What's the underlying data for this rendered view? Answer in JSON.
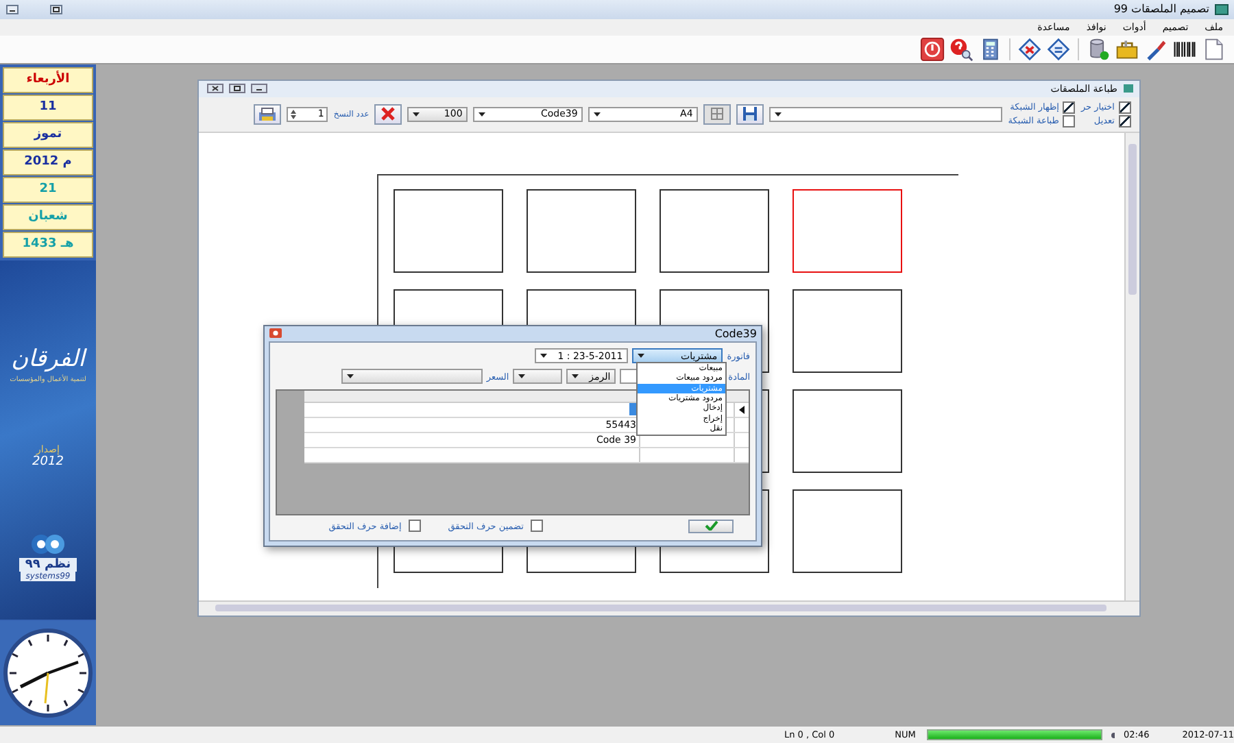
{
  "window": {
    "title": "تصميم الملصقات 99"
  },
  "menu": [
    "ملف",
    "تصميم",
    "أدوات",
    "نوافذ",
    "مساعدة"
  ],
  "calendar": [
    {
      "text": "الأربعاء",
      "color": "#cc0000"
    },
    {
      "text": "11",
      "color": "#1a2fa0"
    },
    {
      "text": "تموز",
      "color": "#1a2fa0"
    },
    {
      "text": "2012 م",
      "color": "#1a2fa0"
    },
    {
      "text": "21",
      "color": "#15a0a8"
    },
    {
      "text": "شعبان",
      "color": "#15a0a8"
    },
    {
      "text": "1433 هـ",
      "color": "#15a0a8"
    }
  ],
  "banner": {
    "title": "الفرقان",
    "subtitle": "لتنمية الأعمال والمؤسسات",
    "edition": "إصدار",
    "year": "2012"
  },
  "brand": {
    "name": "نظم ٩٩",
    "latin": "systems99"
  },
  "child_window": {
    "title": "طباعة الملصقات",
    "edit_options": [
      {
        "label": "اختيار حر",
        "checked": true
      },
      {
        "label": "تعديل",
        "checked": true
      }
    ],
    "grid_options": [
      {
        "label": "إظهار الشبكة",
        "checked": true
      },
      {
        "label": "طباعة الشبكة",
        "checked": false
      }
    ],
    "paper": "A4",
    "barcode_type": "Code39",
    "zoom": "100",
    "copies_label": "عدد النسخ",
    "copies": "1",
    "label_rows": [
      [
        {
          "selected": false
        },
        {
          "selected": false
        },
        {
          "selected": false
        },
        {
          "selected": true
        }
      ],
      [
        {
          "selected": false
        },
        {
          "selected": false
        },
        {
          "selected": false
        },
        {
          "selected": false
        }
      ],
      [
        {
          "selected": false
        }
      ],
      [
        {
          "selected": false
        },
        {
          "selected": false
        },
        {
          "selected": false
        },
        {
          "selected": false
        }
      ]
    ]
  },
  "dialog": {
    "title": "Code39",
    "invoice_label": "فاتورة",
    "invoice_type": "مشتريات",
    "invoice_number": "1 : 23-5-2011",
    "invoice_options": [
      {
        "label": "مبيعات",
        "selected": false
      },
      {
        "label": "مردود مبيعات",
        "selected": false
      },
      {
        "label": "مشتريات",
        "selected": true
      },
      {
        "label": "مردود مشتريات",
        "selected": false
      },
      {
        "label": "إدخال",
        "selected": false
      },
      {
        "label": "إخراج",
        "selected": false
      },
      {
        "label": "نقل",
        "selected": false
      }
    ],
    "item_label": "المادة",
    "code_combo": "الرمز",
    "price_label": "السعر",
    "rows": [
      {
        "selected": true
      },
      {
        "value": "55443",
        "selected": false
      },
      {
        "value": "Code 39",
        "selected": false
      },
      {
        "selected": false
      }
    ],
    "checks": [
      {
        "label": "تضمين حرف التحقق",
        "checked": false
      },
      {
        "label": "إضافة حرف التحقق",
        "checked": false
      }
    ]
  },
  "status_bar": {
    "position": "Ln 0 , Col 0",
    "num": "NUM",
    "progress": {
      "level": 1
    },
    "time": "02:46",
    "date": "2012-07-11"
  }
}
